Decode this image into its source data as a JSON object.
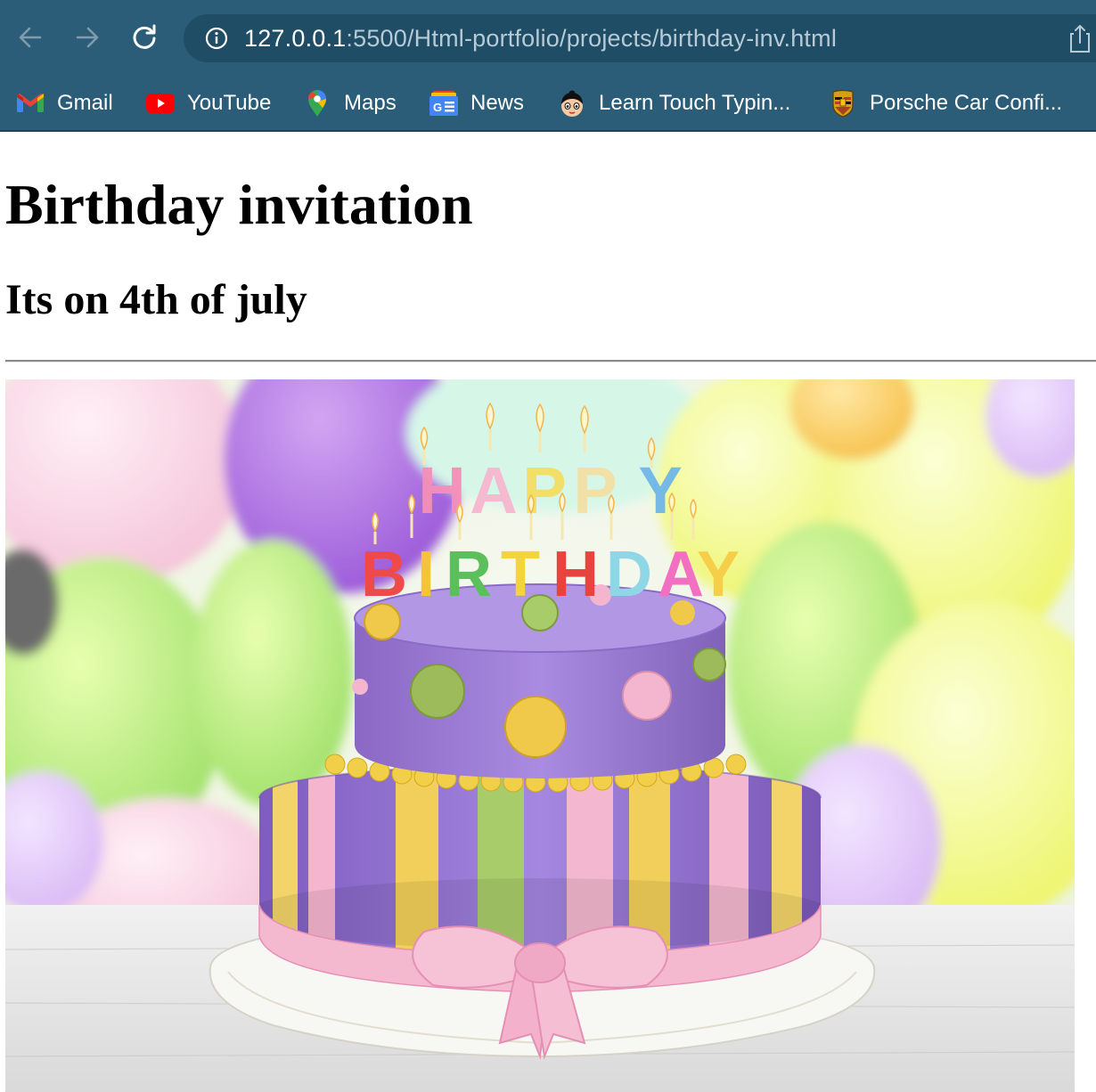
{
  "browser": {
    "url_host": "127.0.0.1",
    "url_rest": ":5500/Html-portfolio/projects/birthday-inv.html",
    "bookmarks": [
      {
        "label": "Gmail",
        "icon": "gmail-icon"
      },
      {
        "label": "YouTube",
        "icon": "youtube-icon"
      },
      {
        "label": "Maps",
        "icon": "maps-icon"
      },
      {
        "label": "News",
        "icon": "google-news-icon"
      },
      {
        "label": "Learn Touch Typin...",
        "icon": "typing-site-icon"
      },
      {
        "label": "Porsche Car Confi...",
        "icon": "porsche-icon"
      }
    ],
    "colors": {
      "chrome": "#2b5d78",
      "omnibox": "#1f4d66"
    }
  },
  "page": {
    "title": "Birthday invitation",
    "subtitle": "Its on 4th of july",
    "image": {
      "subject": "birthday-cake-photo",
      "cake_topper_line1": "HAPPY",
      "cake_topper_line2": "BIRTHDAY"
    }
  }
}
